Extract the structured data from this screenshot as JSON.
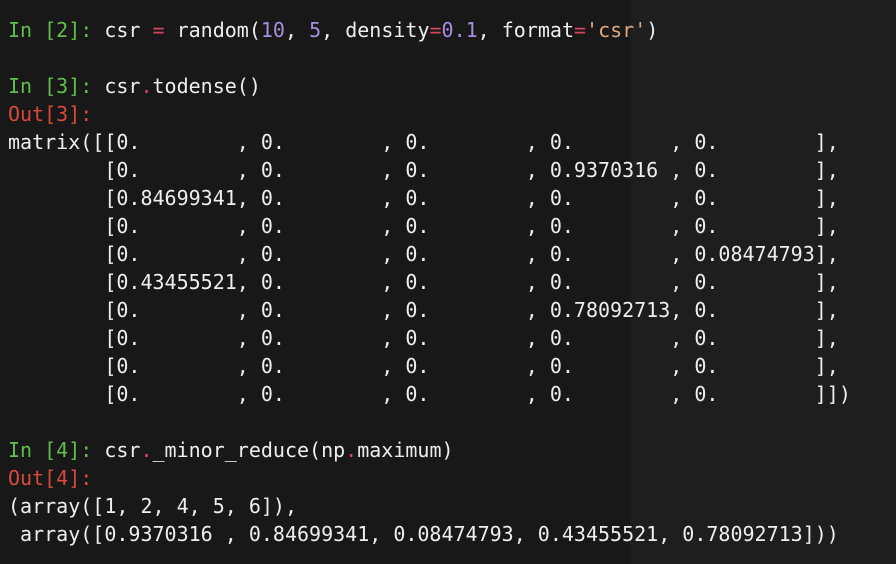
{
  "background": {
    "colors": {
      "terminal_bg": "#181818",
      "in_prompt": "#5fbe4a",
      "out_prompt": "#d64a3a",
      "number": "#a78ce0",
      "operator": "#d6455c",
      "string": "#e0a97a",
      "text": "#eeeeee"
    }
  },
  "cells": [
    {
      "in_prompt": "In [2]:",
      "tokens": [
        {
          "t": " csr ",
          "k": "plain"
        },
        {
          "t": "=",
          "k": "op"
        },
        {
          "t": " random(",
          "k": "plain"
        },
        {
          "t": "10",
          "k": "num"
        },
        {
          "t": ", ",
          "k": "plain"
        },
        {
          "t": "5",
          "k": "num"
        },
        {
          "t": ", density",
          "k": "plain"
        },
        {
          "t": "=",
          "k": "op"
        },
        {
          "t": "0.1",
          "k": "num"
        },
        {
          "t": ", format",
          "k": "plain"
        },
        {
          "t": "=",
          "k": "op"
        },
        {
          "t": "'csr'",
          "k": "str"
        },
        {
          "t": ")",
          "k": "plain"
        }
      ]
    },
    {
      "in_prompt": "In [3]:",
      "tokens": [
        {
          "t": " csr",
          "k": "plain"
        },
        {
          "t": ".",
          "k": "op"
        },
        {
          "t": "todense()",
          "k": "plain"
        }
      ],
      "out_prompt": "Out[3]:",
      "output_lines": [
        "matrix([[0.        , 0.        , 0.        , 0.        , 0.        ],",
        "        [0.        , 0.        , 0.        , 0.9370316 , 0.        ],",
        "        [0.84699341, 0.        , 0.        , 0.        , 0.        ],",
        "        [0.        , 0.        , 0.        , 0.        , 0.        ],",
        "        [0.        , 0.        , 0.        , 0.        , 0.08474793],",
        "        [0.43455521, 0.        , 0.        , 0.        , 0.        ],",
        "        [0.        , 0.        , 0.        , 0.78092713, 0.        ],",
        "        [0.        , 0.        , 0.        , 0.        , 0.        ],",
        "        [0.        , 0.        , 0.        , 0.        , 0.        ],",
        "        [0.        , 0.        , 0.        , 0.        , 0.        ]])"
      ]
    },
    {
      "in_prompt": "In [4]:",
      "tokens": [
        {
          "t": " csr",
          "k": "plain"
        },
        {
          "t": ".",
          "k": "op"
        },
        {
          "t": "_minor_reduce(np",
          "k": "plain"
        },
        {
          "t": ".",
          "k": "op"
        },
        {
          "t": "maximum)",
          "k": "plain"
        }
      ],
      "out_prompt": "Out[4]:",
      "output_lines": [
        "(array([1, 2, 4, 5, 6]),",
        " array([0.9370316 , 0.84699341, 0.08474793, 0.43455521, 0.78092713]))"
      ]
    }
  ]
}
